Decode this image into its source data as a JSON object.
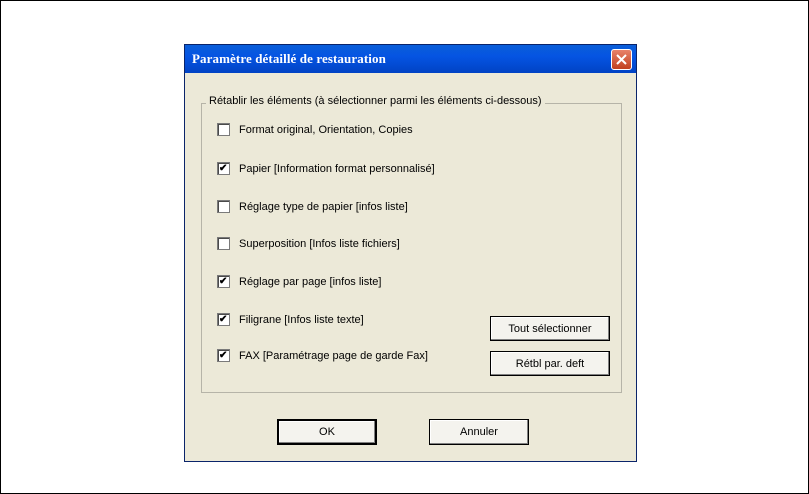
{
  "dialog": {
    "title": "Paramètre détaillé de restauration",
    "group_label": "Rétablir les éléments (à sélectionner parmi les éléments ci-dessous)",
    "options": [
      {
        "label": "Format original, Orientation, Copies",
        "checked": false
      },
      {
        "label": "Papier [Information format personnalisé]",
        "checked": true
      },
      {
        "label": "Réglage type de papier [infos liste]",
        "checked": false
      },
      {
        "label": "Superposition [Infos liste fichiers]",
        "checked": false
      },
      {
        "label": "Réglage par page [infos liste]",
        "checked": true
      },
      {
        "label": "Filigrane [Infos liste texte]",
        "checked": true
      },
      {
        "label": "FAX [Paramétrage page de garde Fax]",
        "checked": true
      }
    ],
    "select_all_label": "Tout sélectionner",
    "reset_default_label": "Rétbl par. deft",
    "ok_label": "OK",
    "cancel_label": "Annuler"
  }
}
